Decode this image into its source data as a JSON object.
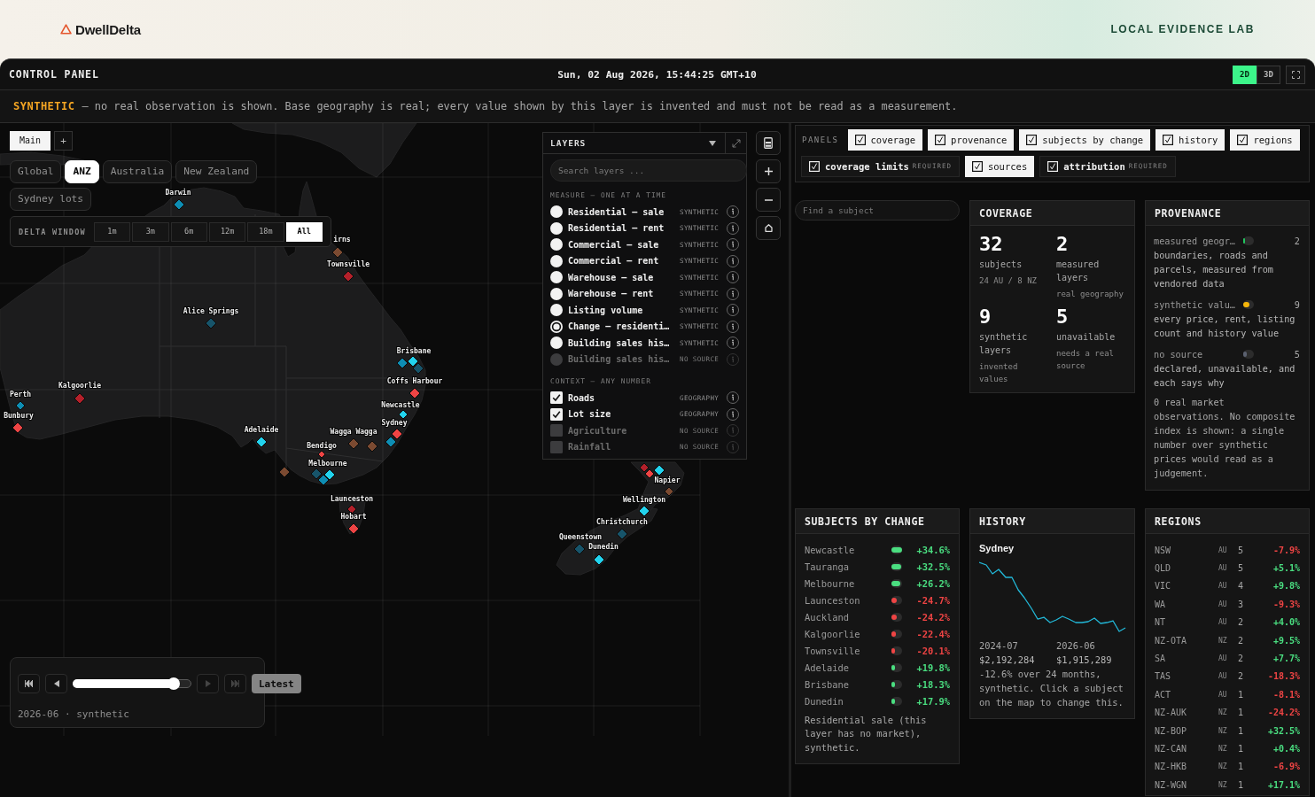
{
  "header": {
    "brand": "DwellDelta",
    "lab": "LOCAL EVIDENCE LAB"
  },
  "topbar": {
    "title": "CONTROL PANEL",
    "datetime": "Sun, 02 Aug 2026, 15:44:25 GMT+10",
    "view_modes": [
      {
        "label": "2D",
        "selected": true
      },
      {
        "label": "3D",
        "selected": false
      }
    ]
  },
  "banner": {
    "label": "SYNTHETIC",
    "text": "— no real observation is shown. Base geography is real; every value shown by this layer is invented and must not be read as a measurement."
  },
  "map": {
    "tabs": [
      {
        "label": "Main",
        "selected": true
      }
    ],
    "add_tab": "+",
    "regions": [
      {
        "label": "Global",
        "selected": false
      },
      {
        "label": "ANZ",
        "selected": true
      },
      {
        "label": "Australia",
        "selected": false
      },
      {
        "label": "New Zealand",
        "selected": false
      },
      {
        "label": "Sydney lots",
        "selected": false
      }
    ],
    "delta_window": {
      "label": "DELTA WINDOW",
      "options": [
        {
          "label": "1m",
          "selected": false
        },
        {
          "label": "3m",
          "selected": false
        },
        {
          "label": "6m",
          "selected": false
        },
        {
          "label": "12m",
          "selected": false
        },
        {
          "label": "18m",
          "selected": false
        },
        {
          "label": "All",
          "selected": true
        }
      ]
    },
    "markers": [
      {
        "label": "Darwin",
        "color": "#0e8db3"
      },
      {
        "label": "irns",
        "color": "#7b4a31"
      },
      {
        "label": "Townsville",
        "color": "#b3202a"
      },
      {
        "label": "Alice Springs",
        "color": "#17546a"
      },
      {
        "label": "Brisbane",
        "color": "#0e8db3"
      },
      {
        "color": "#22d3ee"
      },
      {
        "color": "#17546a"
      },
      {
        "label": "Coffs Harbour",
        "color": "#ef4444"
      },
      {
        "label": "Kalgoorlie",
        "color": "#b3202a"
      },
      {
        "label": "Perth",
        "color": "#0e8db3"
      },
      {
        "label": "Bunbury",
        "color": "#ef4444"
      },
      {
        "label": "Newcastle",
        "color": "#22d3ee"
      },
      {
        "label": "Sydney",
        "color": "#ef4444"
      },
      {
        "color": "#0e8db3"
      },
      {
        "label": "Adelaide",
        "color": "#22d3ee"
      },
      {
        "label": "Wagga Wagga",
        "color": "#7b4a31"
      },
      {
        "color": "#7b4a31"
      },
      {
        "label": "Bendigo",
        "color": "#ef4444"
      },
      {
        "label": "Melbourne",
        "color": "#17546a"
      },
      {
        "color": "#22d3ee"
      },
      {
        "color": "#0e8db3"
      },
      {
        "color": "#7b4a31"
      },
      {
        "label": "Launceston",
        "color": "#b3202a"
      },
      {
        "label": "Hobart",
        "color": "#ef4444"
      },
      {
        "color": "#b3202a"
      },
      {
        "color": "#ef4444"
      },
      {
        "color": "#22d3ee"
      },
      {
        "label": "Napier",
        "color": "#7b4a31"
      },
      {
        "label": "Wellington",
        "color": "#22d3ee"
      },
      {
        "label": "Christchurch",
        "color": "#17546a"
      },
      {
        "label": "Queenstown",
        "color": "#17546a"
      },
      {
        "label": "Dunedin",
        "color": "#22d3ee"
      }
    ],
    "playback": {
      "controls": [
        {
          "kind": "first",
          "disabled": false
        },
        {
          "kind": "previous",
          "disabled": false
        },
        {
          "kind": "next",
          "disabled": true
        },
        {
          "kind": "last",
          "disabled": true
        }
      ],
      "level": 0.85,
      "button": "Latest",
      "caption": "2026-06 · synthetic"
    }
  },
  "layers": {
    "title": "LAYERS",
    "placeholder": "Search layers ...",
    "sections": [
      {
        "title": "MEASURE — ONE AT A TIME",
        "kind": "radio",
        "items": [
          {
            "label": "Residential — sale",
            "tag": "SYNTHETIC",
            "selected": false,
            "disabled": false
          },
          {
            "label": "Residential — rent",
            "tag": "SYNTHETIC",
            "selected": false,
            "disabled": false
          },
          {
            "label": "Commercial — sale",
            "tag": "SYNTHETIC",
            "selected": false,
            "disabled": false
          },
          {
            "label": "Commercial — rent",
            "tag": "SYNTHETIC",
            "selected": false,
            "disabled": false
          },
          {
            "label": "Warehouse — sale",
            "tag": "SYNTHETIC",
            "selected": false,
            "disabled": false
          },
          {
            "label": "Warehouse — rent",
            "tag": "SYNTHETIC",
            "selected": false,
            "disabled": false
          },
          {
            "label": "Listing volume",
            "tag": "SYNTHETIC",
            "selected": false,
            "disabled": false
          },
          {
            "label": "Change — residenti…",
            "tag": "SYNTHETIC",
            "selected": true,
            "disabled": false
          },
          {
            "label": "Building sales his…",
            "tag": "SYNTHETIC",
            "selected": false,
            "disabled": false
          },
          {
            "label": "Building sales his…",
            "tag": "NO SOURCE",
            "selected": false,
            "disabled": true
          }
        ]
      },
      {
        "title": "CONTEXT — ANY NUMBER",
        "kind": "checkbox",
        "items": [
          {
            "label": "Roads",
            "tag": "GEOGRAPHY",
            "checked": true,
            "disabled": false
          },
          {
            "label": "Lot size",
            "tag": "GEOGRAPHY",
            "checked": true,
            "disabled": false
          },
          {
            "label": "Agriculture",
            "tag": "NO SOURCE",
            "checked": false,
            "disabled": true
          },
          {
            "label": "Rainfall",
            "tag": "NO SOURCE",
            "checked": false,
            "disabled": true
          }
        ]
      }
    ]
  },
  "panels": {
    "label": "PANELS",
    "items": [
      {
        "label": "coverage",
        "checked": true,
        "locked": false
      },
      {
        "label": "provenance",
        "checked": true,
        "locked": false
      },
      {
        "label": "subjects by change",
        "checked": true,
        "locked": false
      },
      {
        "label": "history",
        "checked": true,
        "locked": false
      },
      {
        "label": "regions",
        "checked": true,
        "locked": false
      },
      {
        "label": "coverage limits",
        "tag": "REQUIRED",
        "checked": true,
        "locked": true
      },
      {
        "label": "sources",
        "checked": true,
        "locked": false
      },
      {
        "label": "attribution",
        "tag": "REQUIRED",
        "checked": true,
        "locked": true
      }
    ]
  },
  "subject_search": {
    "placeholder": "Find a subject"
  },
  "coverage": {
    "title": "COVERAGE",
    "stats": [
      {
        "value": "32",
        "label": "subjects",
        "note": "24 AU / 8 NZ"
      },
      {
        "value": "2",
        "label": "measured layers",
        "note": "real geography"
      },
      {
        "value": "9",
        "label": "synthetic layers",
        "note": "invented values"
      },
      {
        "value": "5",
        "label": "unavailable",
        "note": "needs a real source"
      }
    ]
  },
  "provenance": {
    "title": "PROVENANCE",
    "groups": [
      {
        "name": "measured geogr…",
        "count": "2",
        "level": 0.15,
        "color": "#22c55e",
        "description": "boundaries, roads and parcels, measured from vendored data"
      },
      {
        "name": "synthetic valu…",
        "count": "9",
        "level": 0.55,
        "color": "#f5b50a",
        "description": "every price, rent, listing count and history value"
      },
      {
        "name": "no source",
        "count": "5",
        "level": 0.35,
        "color": "#5b6170",
        "description": "declared, unavailable, and each says why"
      }
    ],
    "note": "0 real market observations. No composite index is shown: a single number over synthetic prices would read as a judgement."
  },
  "subjects_by_change": {
    "title": "SUBJECTS BY CHANGE",
    "rows": [
      {
        "name": "Newcastle",
        "change": "+34.6%",
        "level": 1,
        "color": "#4ade80"
      },
      {
        "name": "Tauranga",
        "change": "+32.5%",
        "level": 0.95,
        "color": "#4ade80"
      },
      {
        "name": "Melbourne",
        "change": "+26.2%",
        "level": 0.8,
        "color": "#4ade80"
      },
      {
        "name": "Launceston",
        "change": "-24.7%",
        "level": 0.5,
        "color": "#ef4444"
      },
      {
        "name": "Auckland",
        "change": "-24.2%",
        "level": 0.5,
        "color": "#ef4444"
      },
      {
        "name": "Kalgoorlie",
        "change": "-22.4%",
        "level": 0.45,
        "color": "#ef4444"
      },
      {
        "name": "Townsville",
        "change": "-20.1%",
        "level": 0.35,
        "color": "#ef4444"
      },
      {
        "name": "Adelaide",
        "change": "+19.8%",
        "level": 0.3,
        "color": "#4ade80"
      },
      {
        "name": "Brisbane",
        "change": "+18.3%",
        "level": 0.3,
        "color": "#4ade80"
      },
      {
        "name": "Dunedin",
        "change": "+17.9%",
        "level": 0.3,
        "color": "#4ade80"
      }
    ],
    "note": "Residential sale (this layer has no market), synthetic."
  },
  "history": {
    "title": "HISTORY",
    "subject": "Sydney",
    "start": {
      "date": "2024-07",
      "value": "$2,192,284"
    },
    "end": {
      "date": "2026-06",
      "value": "$1,915,289"
    },
    "note": "-12.6% over 24 months, synthetic. Click a subject on the map to change this."
  },
  "regions": {
    "title": "REGIONS",
    "rows": [
      {
        "code": "NSW",
        "country": "AU",
        "count": "5",
        "change": "-7.9%",
        "color": "#ef4444"
      },
      {
        "code": "QLD",
        "country": "AU",
        "count": "5",
        "change": "+5.1%",
        "color": "#4ade80"
      },
      {
        "code": "VIC",
        "country": "AU",
        "count": "4",
        "change": "+9.8%",
        "color": "#4ade80"
      },
      {
        "code": "WA",
        "country": "AU",
        "count": "3",
        "change": "-9.3%",
        "color": "#ef4444"
      },
      {
        "code": "NT",
        "country": "AU",
        "count": "2",
        "change": "+4.0%",
        "color": "#4ade80"
      },
      {
        "code": "NZ-OTA",
        "country": "NZ",
        "count": "2",
        "change": "+9.5%",
        "color": "#4ade80"
      },
      {
        "code": "SA",
        "country": "AU",
        "count": "2",
        "change": "+7.7%",
        "color": "#4ade80"
      },
      {
        "code": "TAS",
        "country": "AU",
        "count": "2",
        "change": "-18.3%",
        "color": "#ef4444"
      },
      {
        "code": "ACT",
        "country": "AU",
        "count": "1",
        "change": "-8.1%",
        "color": "#ef4444"
      },
      {
        "code": "NZ-AUK",
        "country": "NZ",
        "count": "1",
        "change": "-24.2%",
        "color": "#ef4444"
      },
      {
        "code": "NZ-BOP",
        "country": "NZ",
        "count": "1",
        "change": "+32.5%",
        "color": "#4ade80"
      },
      {
        "code": "NZ-CAN",
        "country": "NZ",
        "count": "1",
        "change": "+0.4%",
        "color": "#4ade80"
      },
      {
        "code": "NZ-HKB",
        "country": "NZ",
        "count": "1",
        "change": "-6.9%",
        "color": "#ef4444"
      },
      {
        "code": "NZ-WGN",
        "country": "NZ",
        "count": "1",
        "change": "+17.1%",
        "color": "#4ade80"
      }
    ]
  }
}
